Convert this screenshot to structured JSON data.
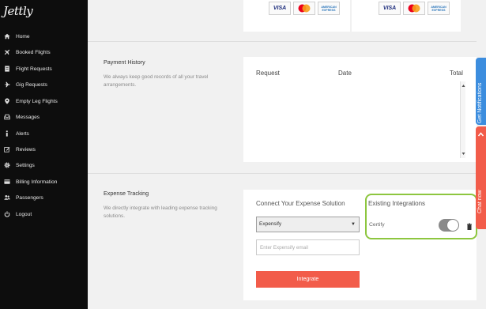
{
  "app": {
    "logo_text": "Jettly"
  },
  "sidebar": {
    "items": [
      {
        "label": "Home",
        "icon": "home-icon"
      },
      {
        "label": "Booked Flights",
        "icon": "plane-icon"
      },
      {
        "label": "Flight Requests",
        "icon": "document-icon"
      },
      {
        "label": "Gig Requests",
        "icon": "plane-icon"
      },
      {
        "label": "Empty Leg Flights",
        "icon": "map-pin-icon"
      },
      {
        "label": "Messages",
        "icon": "inbox-icon"
      },
      {
        "label": "Alerts",
        "icon": "info-icon"
      },
      {
        "label": "Reviews",
        "icon": "edit-icon"
      },
      {
        "label": "Settings",
        "icon": "gear-icon"
      },
      {
        "label": "Billing Information",
        "icon": "credit-card-icon"
      },
      {
        "label": "Passengers",
        "icon": "users-icon"
      },
      {
        "label": "Logout",
        "icon": "power-icon"
      }
    ]
  },
  "cards_accepted": {
    "visa": "VISA",
    "amex": "AMERICAN EXPRESS"
  },
  "payment_history": {
    "title": "Payment History",
    "description": "We always keep good records of all your travel arrangements.",
    "columns": [
      "Request",
      "Date",
      "Total"
    ]
  },
  "expense_tracking": {
    "title": "Expense Tracking",
    "description": "We directly integrate with leading expense tracking solutions.",
    "connect_heading": "Connect Your Expense Solution",
    "selected_solution": "Expensify",
    "email_placeholder": "Enter Expensify email",
    "integrate_label": "Integrate",
    "existing_heading": "Existing Integrations",
    "existing": [
      {
        "name": "Certify",
        "enabled": true
      }
    ]
  },
  "right_tabs": {
    "notifications_label": "Get Notifications",
    "chat_label": "Chat now"
  },
  "colors": {
    "sidebar_bg": "#0d0d0d",
    "accent_red": "#f25c4a",
    "highlight_green": "#8dc63f",
    "notif_blue": "#3c8dde"
  }
}
